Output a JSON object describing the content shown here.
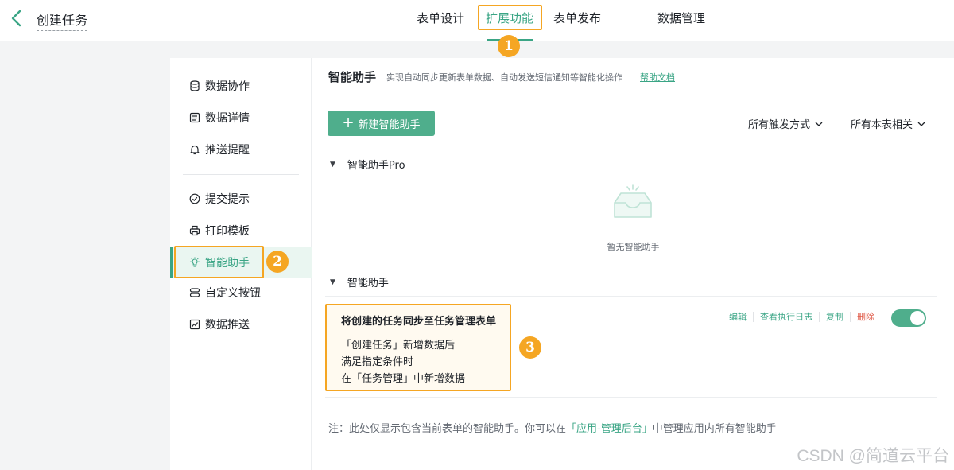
{
  "header": {
    "title": "创建任务",
    "tabs": [
      {
        "label": "表单设计"
      },
      {
        "label": "扩展功能",
        "active": true
      },
      {
        "label": "表单发布"
      },
      {
        "label": "数据管理"
      }
    ]
  },
  "annotations": {
    "one": "1",
    "two": "2",
    "three": "3"
  },
  "sidebar": {
    "items": [
      {
        "label": "数据协作",
        "icon": "database-icon"
      },
      {
        "label": "数据详情",
        "icon": "document-icon"
      },
      {
        "label": "推送提醒",
        "icon": "bell-icon"
      },
      {
        "label": "提交提示",
        "icon": "check-circle-icon"
      },
      {
        "label": "打印模板",
        "icon": "printer-icon"
      },
      {
        "label": "智能助手",
        "icon": "lightbulb-icon",
        "active": true
      },
      {
        "label": "自定义按钮",
        "icon": "buttons-icon"
      },
      {
        "label": "数据推送",
        "icon": "chart-icon"
      }
    ]
  },
  "main": {
    "title": "智能助手",
    "description": "实现自动同步更新表单数据、自动发送短信通知等智能化操作",
    "help_link": "帮助文档",
    "new_button": "新建智能助手",
    "filters": {
      "trigger": "所有触发方式",
      "relation": "所有本表相关"
    },
    "groups": {
      "pro": {
        "title": "智能助手Pro",
        "empty_text": "暂无智能助手"
      },
      "basic": {
        "title": "智能助手",
        "items": [
          {
            "name": "将创建的任务同步至任务管理表单",
            "lines": [
              "「创建任务」新增数据后",
              "满足指定条件时",
              "在「任务管理」中新增数据"
            ],
            "actions": {
              "edit": "编辑",
              "log": "查看执行日志",
              "copy": "复制",
              "delete": "删除"
            },
            "enabled": true
          }
        ]
      }
    },
    "note": {
      "prefix": "注：此处仅显示包含当前表单的智能助手。你可以在",
      "link": "「应用-管理后台」",
      "suffix": "中管理应用内所有智能助手"
    }
  },
  "watermark": "CSDN @简道云平台",
  "colors": {
    "accent": "#3aa585",
    "highlight": "#f5a623",
    "danger": "#e05a48"
  }
}
